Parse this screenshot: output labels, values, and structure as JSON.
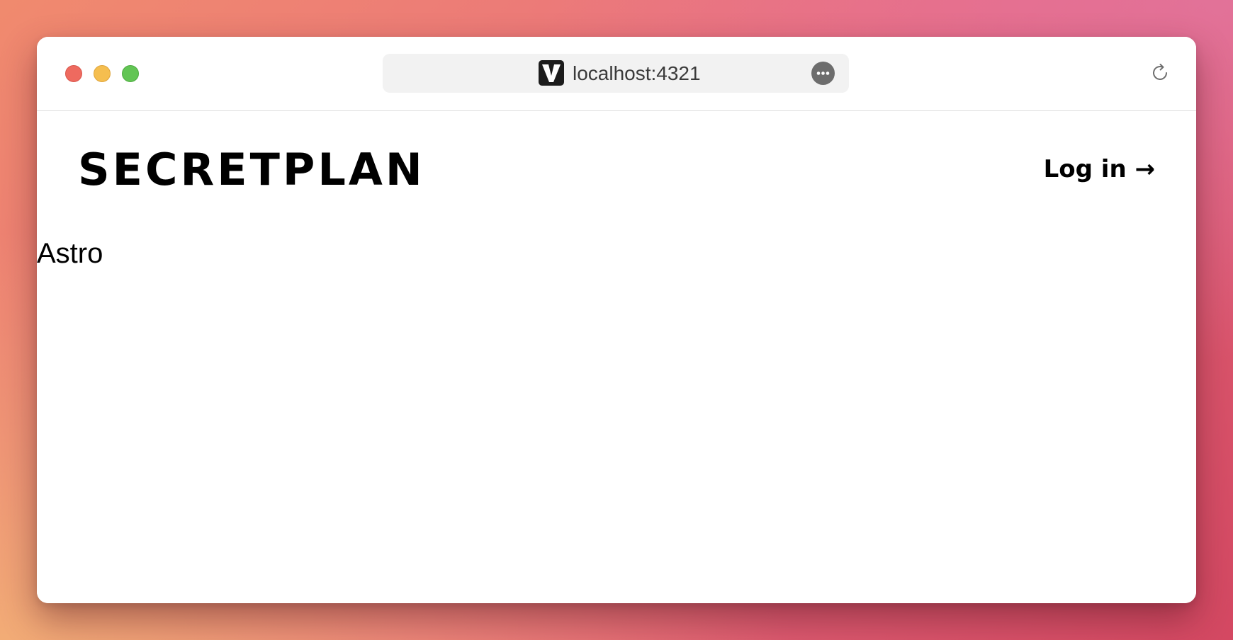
{
  "browser": {
    "url": "localhost:4321",
    "favicon_icon": "vite-logo-icon",
    "more_icon": "ellipsis-circle-icon",
    "reload_icon": "reload-icon"
  },
  "header": {
    "brand": "SECRETPLAN",
    "login_label": "Log in →"
  },
  "main": {
    "text": "Astro"
  },
  "colors": {
    "traffic_red": "#ee6a5f",
    "traffic_yellow": "#f5be4f",
    "traffic_green": "#62c554",
    "background_gradient_start": "#f08a6e",
    "background_gradient_end": "#d44862"
  }
}
